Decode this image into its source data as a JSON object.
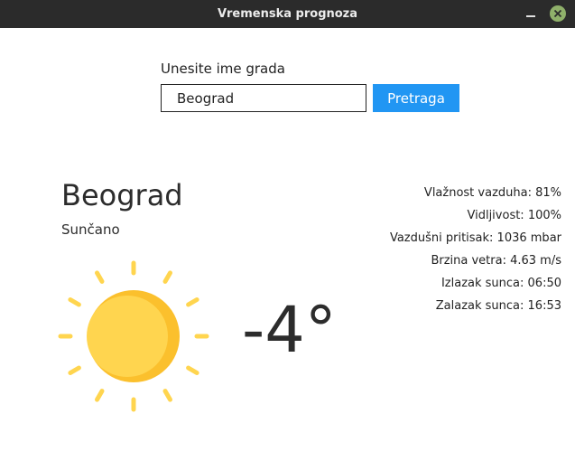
{
  "window": {
    "title": "Vremenska prognoza",
    "controls": [
      "minimize-icon",
      "close-icon"
    ],
    "close_color": "#8fb06a"
  },
  "search": {
    "label": "Unesite ime grada",
    "value": "Beograd",
    "button_label": "Pretraga",
    "button_color": "#2196f3"
  },
  "weather": {
    "city": "Beograd",
    "condition": "Sunčano",
    "icon": "sun-icon",
    "temperature": "-4°",
    "details": [
      "Vlažnost vazduha: 81%",
      "Vidljivost: 100%",
      "Vazdušni pritisak: 1036 mbar",
      "Brzina vetra: 4.63 m/s",
      "Izlazak sunca: 06:50",
      "Zalazak sunca: 16:53"
    ],
    "sun_colors": {
      "face": "#ffd54f",
      "shade": "#fbc02d",
      "rays": "#ffd54f"
    }
  }
}
